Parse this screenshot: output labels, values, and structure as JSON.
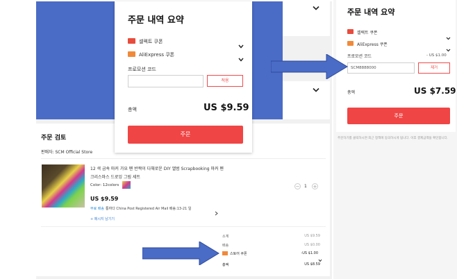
{
  "popup": {
    "title": "주문 내역 요약",
    "selected_coupon_label": "셀렉트 쿠폰",
    "aliexpress_coupon_label": "AliExpress 쿠폰",
    "promo_code_label": "프로모션 코드",
    "promo_input_value": "",
    "apply_label": "적용",
    "total_label": "총액",
    "total_value": "US $9.59",
    "pay_label": "주문"
  },
  "order_review": {
    "title": "주문 검토",
    "seller": "판매자: SCM Official Store",
    "product_name_line1": "12 색 금속 마커 가요 펜 반짝이 다채로운 DIY 앨범 Scrapbooking 마커 펜",
    "product_name_line2": "크리스마스 드로잉 그림 세트",
    "color_label": "Color: 12colors",
    "quantity": "1",
    "price": "US $9.59",
    "free_shipping_tag": "무료 배송",
    "shipping_info": "통하다 China Post Registered Air Mail 배송:13-21 일",
    "message_link": "+ 메시지 남기기",
    "summary": {
      "subtotal_label": "소계",
      "subtotal_value": "US $9.59",
      "shipping_label": "배송",
      "shipping_value": "US $0.00",
      "store_coupon_label": "스토어 쿠폰",
      "store_coupon_value": "-US $1.00",
      "total_label": "총액",
      "total_value": "US $8.59"
    }
  },
  "right_summary": {
    "title": "주문 내역 요약",
    "selected_coupon_label": "셀렉트 쿠폰",
    "aliexpress_coupon_label": "AliExpress 쿠폰",
    "promo_code_label": "프로모션 코드",
    "promo_discount": "- US $1.00",
    "promo_input_value": "SCM8888000",
    "remove_label": "제거",
    "total_label": "총액",
    "total_value": "US $7.59",
    "pay_label": "주문",
    "footer_note": "주문하기를 클릭하시면 최근 정책에 동의하시게 됩니다. 이후 결제금액을 확인합니다."
  },
  "colors": {
    "accent_red": "#f04545",
    "arrow_blue": "#4a6cc6",
    "coupon_flag": "#e84c3d"
  }
}
